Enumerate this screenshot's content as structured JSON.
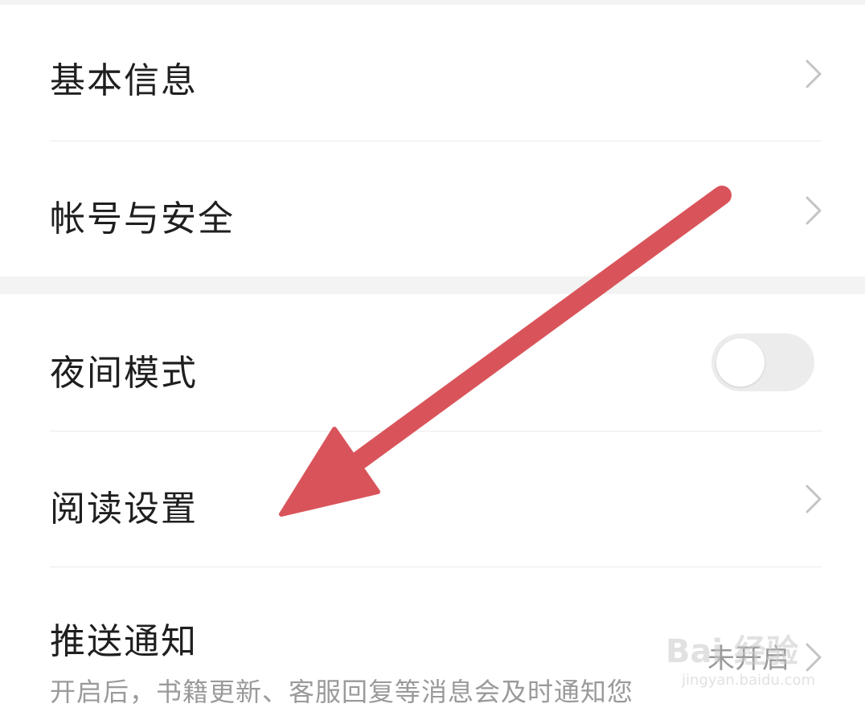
{
  "settings": {
    "items": [
      {
        "label": "基本信息"
      },
      {
        "label": "帐号与安全"
      },
      {
        "label": "夜间模式"
      },
      {
        "label": "阅读设置"
      },
      {
        "label": "推送通知",
        "value": "未开启",
        "description": "开启后，书籍更新、客服回复等消息会及时通知您"
      }
    ],
    "night_mode": {
      "enabled": false
    }
  },
  "watermark": {
    "text": "Bai 经验",
    "url": "jingyan.baidu.com"
  },
  "colors": {
    "annotation_arrow": "#d9545a",
    "divider": "#ececec",
    "section_gap": "#f3f3f3",
    "secondary_text": "#9a9a9a"
  },
  "icons": {
    "row_chevron": "chevron-right-icon"
  }
}
